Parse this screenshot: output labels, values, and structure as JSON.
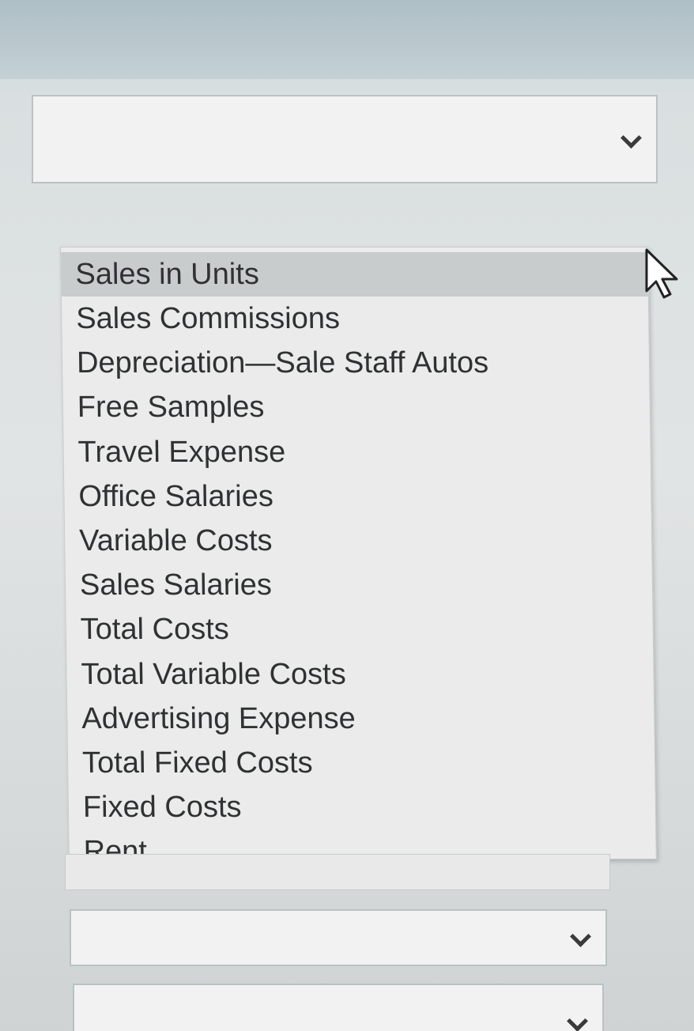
{
  "dropdown": {
    "selected_value": "",
    "options": [
      {
        "label": "Sales in Units",
        "highlighted": true
      },
      {
        "label": "Sales Commissions",
        "highlighted": false
      },
      {
        "label": "Depreciation—Sale Staff Autos",
        "highlighted": false
      },
      {
        "label": "Free Samples",
        "highlighted": false
      },
      {
        "label": "Travel Expense",
        "highlighted": false
      },
      {
        "label": "Office Salaries",
        "highlighted": false
      },
      {
        "label": "Variable Costs",
        "highlighted": false
      },
      {
        "label": "Sales Salaries",
        "highlighted": false
      },
      {
        "label": "Total Costs",
        "highlighted": false
      },
      {
        "label": "Total Variable Costs",
        "highlighted": false
      },
      {
        "label": "Advertising Expense",
        "highlighted": false
      },
      {
        "label": "Total Fixed Costs",
        "highlighted": false
      },
      {
        "label": "Fixed Costs",
        "highlighted": false
      },
      {
        "label": "Rent",
        "highlighted": false
      }
    ]
  },
  "other_selects": [
    {
      "selected_value": ""
    },
    {
      "selected_value": ""
    }
  ],
  "icons": {
    "dropdown_arrow": "chevron-down-icon",
    "cursor": "mouse-pointer-icon"
  },
  "colors": {
    "highlight": "#c8cccd",
    "text": "#2f3133"
  }
}
